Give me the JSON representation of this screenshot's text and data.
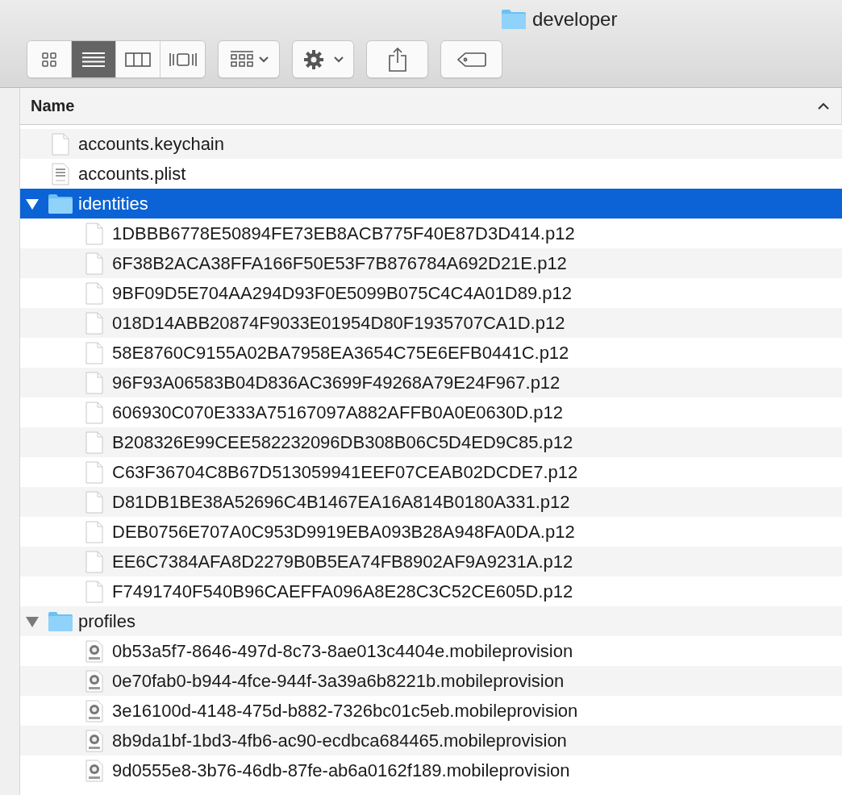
{
  "window": {
    "title": "developer"
  },
  "toolbar": {
    "view_modes": [
      {
        "kind": "icons",
        "selected": false
      },
      {
        "kind": "list",
        "selected": true
      },
      {
        "kind": "columns",
        "selected": false
      },
      {
        "kind": "coverflow",
        "selected": false
      }
    ],
    "buttons": [
      {
        "kind": "arrange"
      },
      {
        "kind": "action"
      },
      {
        "kind": "share"
      },
      {
        "kind": "tags"
      }
    ]
  },
  "table": {
    "columns": [
      {
        "label": "Name",
        "sort_ascending": true
      }
    ],
    "rows": [
      {
        "name": "accounts.keychain",
        "kind": "file",
        "selected": false
      },
      {
        "name": "accounts.plist",
        "kind": "plist",
        "selected": false
      },
      {
        "name": "identities",
        "kind": "folder",
        "selected": true,
        "expanded": true,
        "children": [
          {
            "name": "1DBBB6778E50894FE73EB8ACB775F40E87D3D414.p12",
            "kind": "file",
            "selected": false
          },
          {
            "name": "6F38B2ACA38FFA166F50E53F7B876784A692D21E.p12",
            "kind": "file",
            "selected": false
          },
          {
            "name": "9BF09D5E704AA294D93F0E5099B075C4C4A01D89.p12",
            "kind": "file",
            "selected": false
          },
          {
            "name": "018D14ABB20874F9033E01954D80F1935707CA1D.p12",
            "kind": "file",
            "selected": false
          },
          {
            "name": "58E8760C9155A02BA7958EA3654C75E6EFB0441C.p12",
            "kind": "file",
            "selected": false
          },
          {
            "name": "96F93A06583B04D836AC3699F49268A79E24F967.p12",
            "kind": "file",
            "selected": false
          },
          {
            "name": "606930C070E333A75167097A882AFFB0A0E0630D.p12",
            "kind": "file",
            "selected": false
          },
          {
            "name": "B208326E99CEE582232096DB308B06C5D4ED9C85.p12",
            "kind": "file",
            "selected": false
          },
          {
            "name": "C63F36704C8B67D513059941EEF07CEAB02DCDE7.p12",
            "kind": "file",
            "selected": false
          },
          {
            "name": "D81DB1BE38A52696C4B1467EA16A814B0180A331.p12",
            "kind": "file",
            "selected": false
          },
          {
            "name": "DEB0756E707A0C953D9919EBA093B28A948FA0DA.p12",
            "kind": "file",
            "selected": false
          },
          {
            "name": "EE6C7384AFA8D2279B0B5EA74FB8902AF9A9231A.p12",
            "kind": "file",
            "selected": false
          },
          {
            "name": "F7491740F540B96CAEFFA096A8E28C3C52CE605D.p12",
            "kind": "file",
            "selected": false
          }
        ]
      },
      {
        "name": "profiles",
        "kind": "folder",
        "selected": false,
        "expanded": true,
        "children": [
          {
            "name": "0b53a5f7-8646-497d-8c73-8ae013c4404e.mobileprovision",
            "kind": "provision",
            "selected": false
          },
          {
            "name": "0e70fab0-b944-4fce-944f-3a39a6b8221b.mobileprovision",
            "kind": "provision",
            "selected": false
          },
          {
            "name": "3e16100d-4148-475d-b882-7326bc01c5eb.mobileprovision",
            "kind": "provision",
            "selected": false
          },
          {
            "name": "8b9da1bf-1bd3-4fb6-ac90-ecdbca684465.mobileprovision",
            "kind": "provision",
            "selected": false
          },
          {
            "name": "9d0555e8-3b76-46db-87fe-ab6a0162f189.mobileprovision",
            "kind": "provision",
            "selected": false
          }
        ]
      }
    ]
  }
}
